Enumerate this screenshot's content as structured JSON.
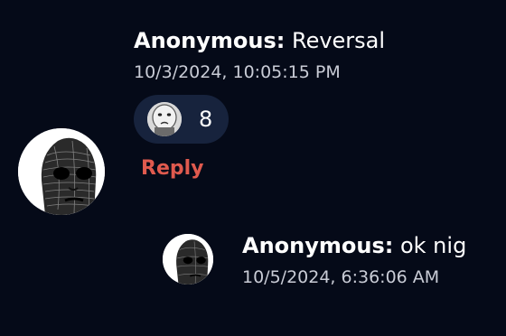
{
  "comment": {
    "author": "Anonymous:",
    "text": " Reversal",
    "timestamp": "10/3/2024, 10:05:15 PM",
    "reaction": {
      "icon": "wojak-face-emoji",
      "count": "8"
    },
    "reply_label": "Reply",
    "avatar_icon": "sad-face-sketch-avatar"
  },
  "reply": {
    "author": "Anonymous:",
    "text": " ok nig",
    "timestamp": "10/5/2024, 6:36:06 AM",
    "avatar_icon": "sad-face-sketch-avatar"
  },
  "colors": {
    "background": "#050a18",
    "pill": "#17233d",
    "reply_accent": "#e05a4e",
    "timestamp": "#c9ccd6"
  }
}
